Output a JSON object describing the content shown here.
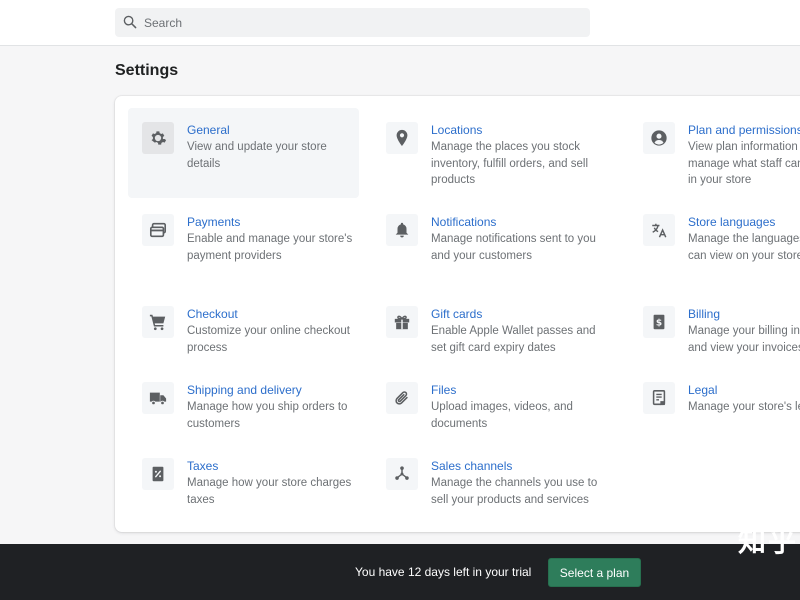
{
  "search": {
    "placeholder": "Search"
  },
  "page": {
    "title": "Settings"
  },
  "settings": [
    {
      "title": "General",
      "desc": "View and update your store details",
      "icon": "gear-icon"
    },
    {
      "title": "Locations",
      "desc": "Manage the places you stock inventory, fulfill orders, and sell products",
      "icon": "location-pin-icon"
    },
    {
      "title": "Plan and permissions",
      "desc": "View plan information and manage what staff can see or do in your store",
      "icon": "user-circle-icon"
    },
    {
      "title": "Payments",
      "desc": "Enable and manage your store's payment providers",
      "icon": "credit-card-icon"
    },
    {
      "title": "Notifications",
      "desc": "Manage notifications sent to you and your customers",
      "icon": "bell-icon"
    },
    {
      "title": "Store languages",
      "desc": "Manage the languages customers can view on your store",
      "icon": "translate-icon"
    },
    {
      "title": "Checkout",
      "desc": "Customize your online checkout process",
      "icon": "cart-icon"
    },
    {
      "title": "Gift cards",
      "desc": "Enable Apple Wallet passes and set gift card expiry dates",
      "icon": "gift-icon"
    },
    {
      "title": "Billing",
      "desc": "Manage your billing information and view your invoices",
      "icon": "dollar-bill-icon"
    },
    {
      "title": "Shipping and delivery",
      "desc": "Manage how you ship orders to customers",
      "icon": "truck-icon"
    },
    {
      "title": "Files",
      "desc": "Upload images, videos, and documents",
      "icon": "paperclip-icon"
    },
    {
      "title": "Legal",
      "desc": "Manage your store's legal pages",
      "icon": "document-icon"
    },
    {
      "title": "Taxes",
      "desc": "Manage how your store charges taxes",
      "icon": "receipt-icon"
    },
    {
      "title": "Sales channels",
      "desc": "Manage the channels you use to sell your products and services",
      "icon": "channels-icon"
    }
  ],
  "footer": {
    "message": "You have 12 days left in your trial",
    "button_label": "Select a plan"
  },
  "watermark": {
    "text": "知乎"
  },
  "colors": {
    "link": "#2c6ecb",
    "primary_button": "#2e7d5b",
    "footer_bg": "#1f2124"
  }
}
